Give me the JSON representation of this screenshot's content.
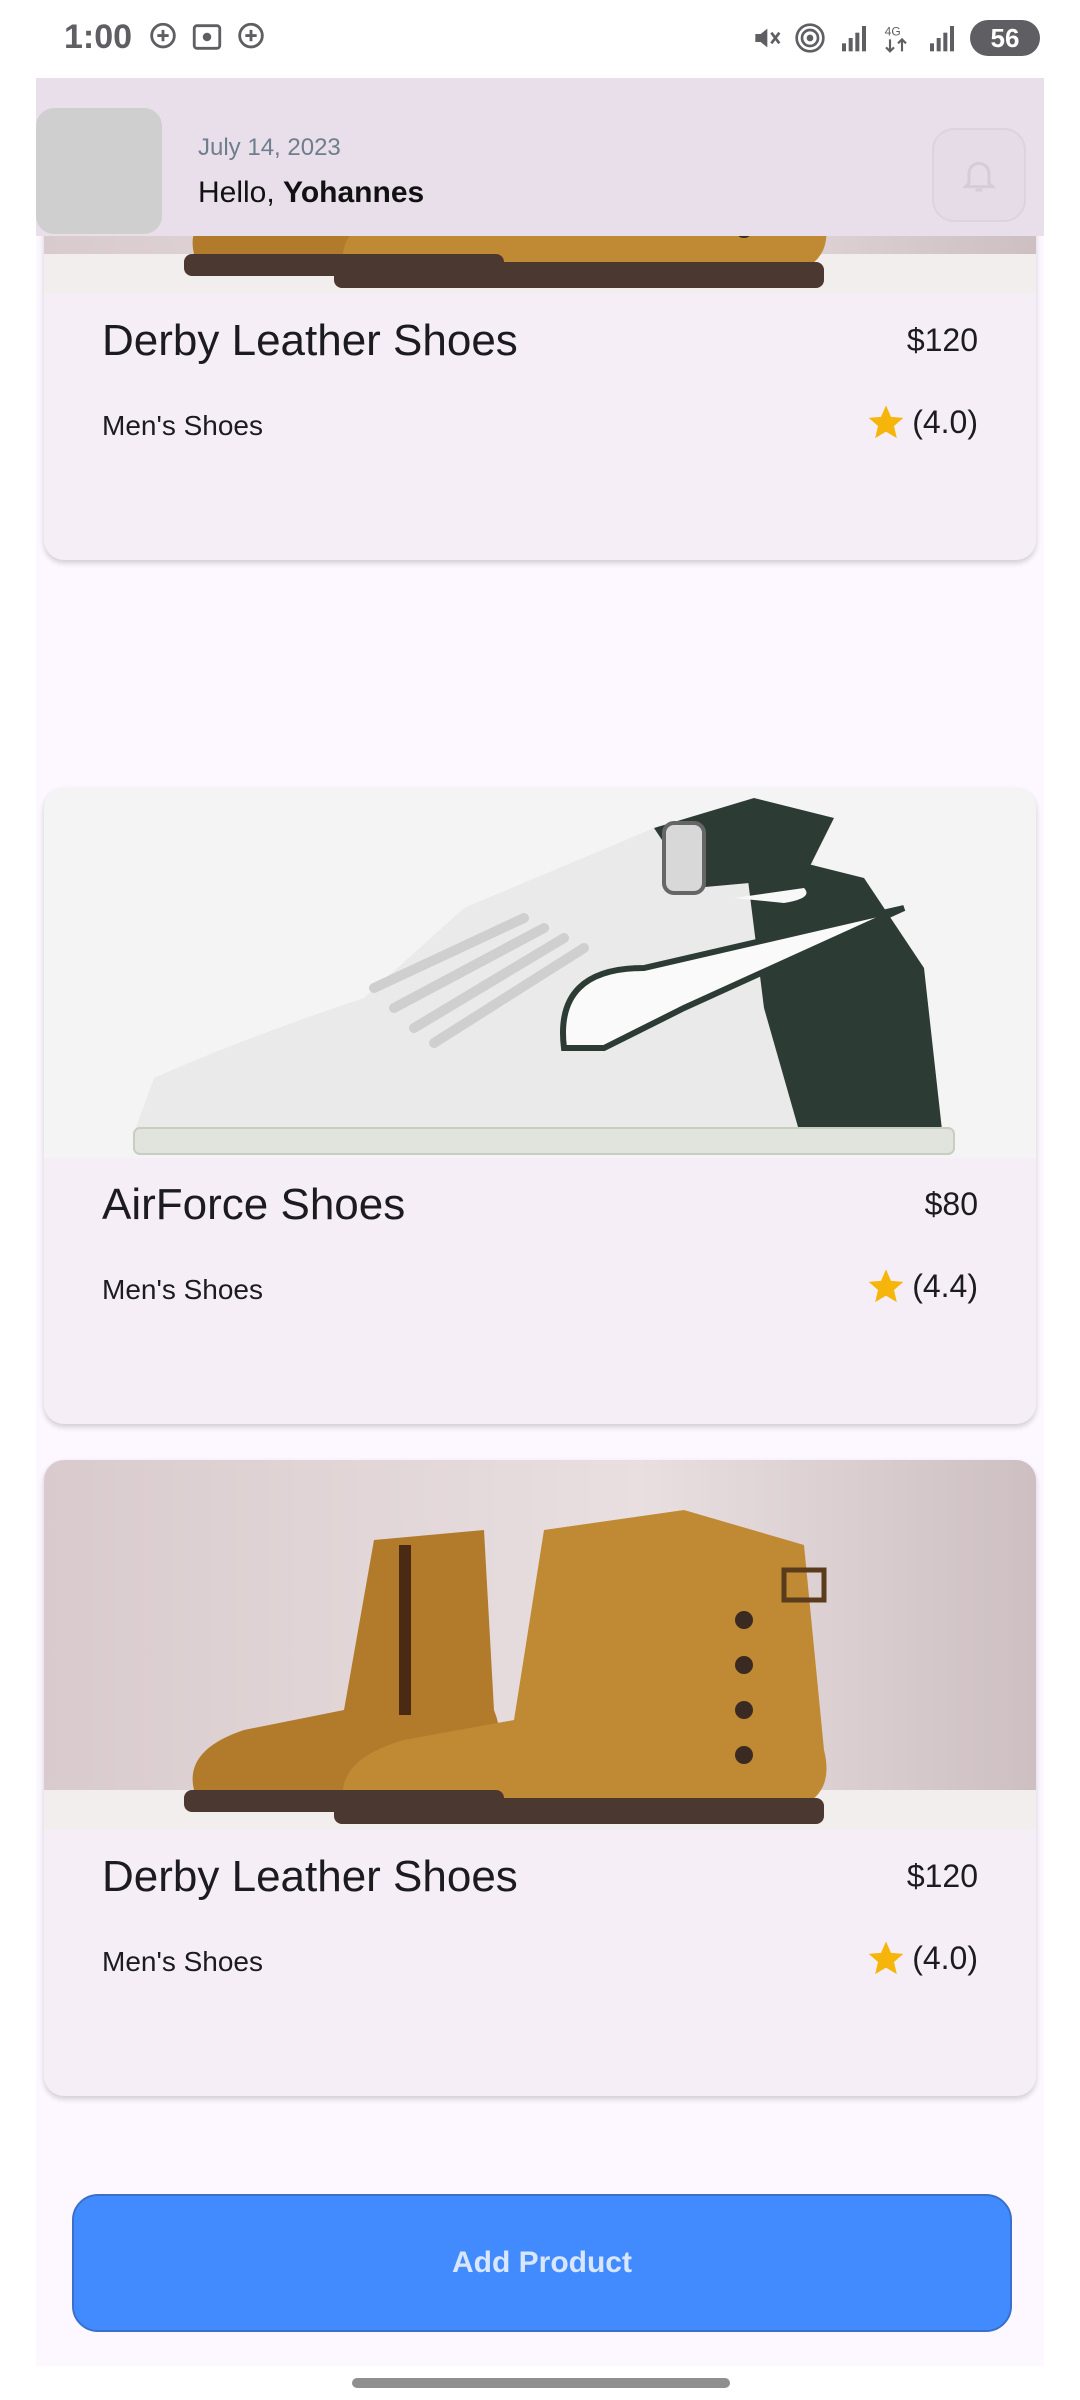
{
  "status_bar": {
    "time": "1:00",
    "battery": "56",
    "icons_left": [
      "location-add-icon",
      "screenshot-icon",
      "location-add-icon"
    ],
    "icons_right": [
      "mute-vibrate-icon",
      "hotspot-icon",
      "signal-icon",
      "4g-signal-icon",
      "signal-icon",
      "battery-charging-icon"
    ]
  },
  "header": {
    "date": "July 14, 2023",
    "greeting_prefix": "Hello, ",
    "user_name": "Yohannes",
    "notification_icon": "bell-icon"
  },
  "products": [
    {
      "title": "Derby Leather Shoes",
      "price": "$120",
      "category": "Men's Shoes",
      "rating": "(4.0)",
      "image": "brown-leather-boots"
    },
    {
      "title": "AirForce Shoes",
      "price": "$80",
      "category": "Men's Shoes",
      "rating": "(4.4)",
      "image": "white-high-top-sneaker"
    },
    {
      "title": "Derby Leather Shoes",
      "price": "$120",
      "category": "Men's Shoes",
      "rating": "(4.0)",
      "image": "brown-leather-boots"
    }
  ],
  "add_button": {
    "label": "Add Product"
  },
  "colors": {
    "header_bg": "#e8dfea",
    "card_bg": "#f6eef7",
    "star": "#f5b50a",
    "button": "#428bff"
  }
}
